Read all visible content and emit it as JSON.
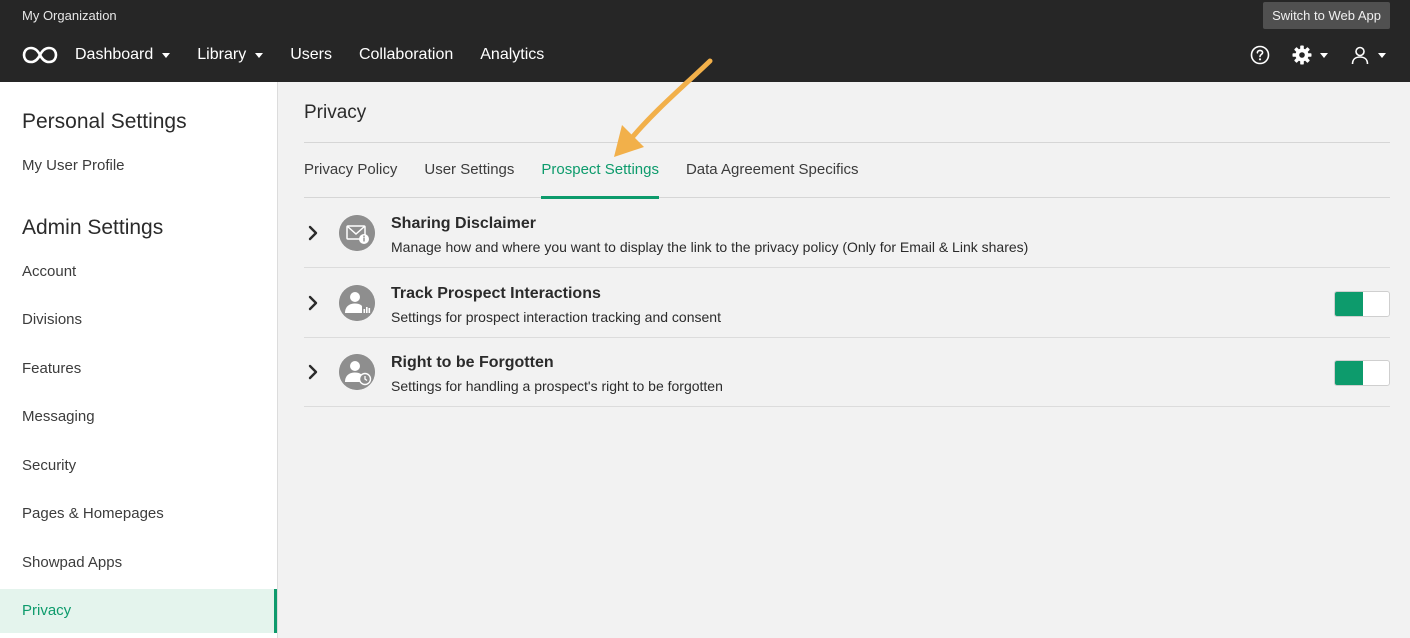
{
  "topbar": {
    "org_name": "My Organization",
    "switch_label": "Switch to Web App",
    "nav": [
      {
        "label": "Dashboard",
        "dropdown": true
      },
      {
        "label": "Library",
        "dropdown": true
      },
      {
        "label": "Users",
        "dropdown": false
      },
      {
        "label": "Collaboration",
        "dropdown": false
      },
      {
        "label": "Analytics",
        "dropdown": false
      }
    ],
    "icons": [
      "help-icon",
      "gear-icon",
      "user-icon"
    ]
  },
  "sidebar": {
    "personal_heading": "Personal Settings",
    "personal_items": [
      {
        "label": "My User Profile"
      }
    ],
    "admin_heading": "Admin Settings",
    "admin_items": [
      {
        "label": "Account"
      },
      {
        "label": "Divisions"
      },
      {
        "label": "Features"
      },
      {
        "label": "Messaging"
      },
      {
        "label": "Security"
      },
      {
        "label": "Pages & Homepages"
      },
      {
        "label": "Showpad Apps"
      },
      {
        "label": "Privacy",
        "active": true
      }
    ]
  },
  "main": {
    "title": "Privacy",
    "tabs": [
      {
        "label": "Privacy Policy"
      },
      {
        "label": "User Settings"
      },
      {
        "label": "Prospect Settings",
        "active": true
      },
      {
        "label": "Data Agreement Specifics"
      }
    ],
    "rows": [
      {
        "title": "Sharing Disclaimer",
        "description": "Manage how and where you want to display the link to the privacy policy (Only for Email & Link shares)",
        "icon": "envelope-info-icon",
        "toggle": null
      },
      {
        "title": "Track Prospect Interactions",
        "description": "Settings for prospect interaction tracking and consent",
        "icon": "user-chart-icon",
        "toggle": true
      },
      {
        "title": "Right to be Forgotten",
        "description": "Settings for handling a prospect's right to be forgotten",
        "icon": "user-clock-icon",
        "toggle": true
      }
    ]
  },
  "colors": {
    "accent": "#0d9b6c",
    "topbar": "#262626",
    "annotation_arrow": "#f2b04a"
  }
}
